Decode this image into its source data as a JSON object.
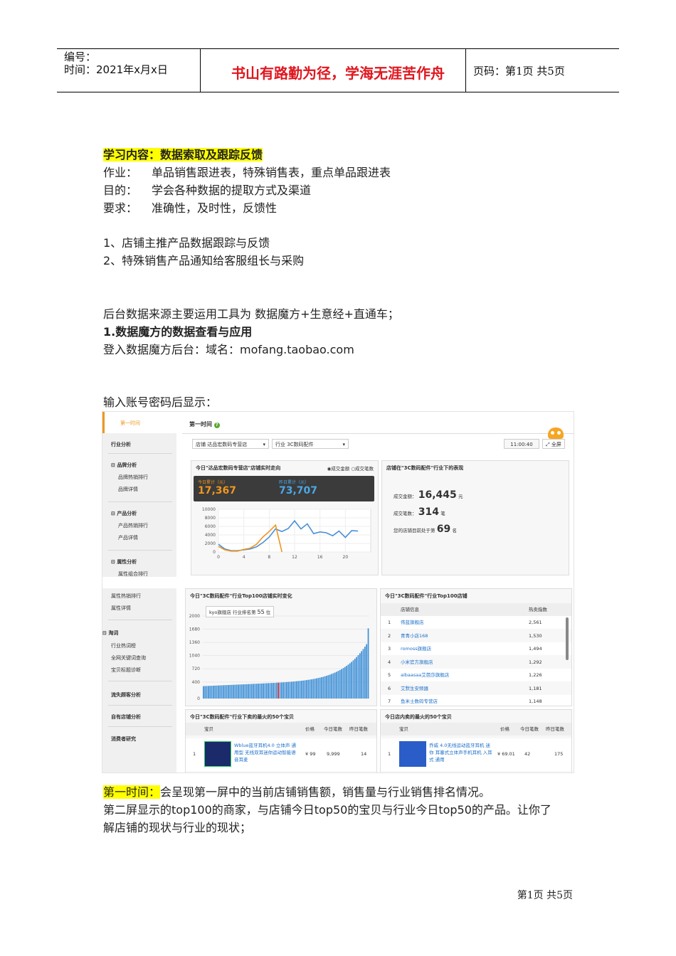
{
  "header": {
    "number_label": "编号：",
    "date_label": "时间：2021年x月x日",
    "motto": "书山有路勤为径，学海无涯苦作舟",
    "page_label": "页码：第1页 共5页"
  },
  "intro": {
    "study_content": "学习内容：数据索取及跟踪反馈",
    "rows": [
      {
        "label": "作业：",
        "value": "单品销售跟进表，特殊销售表，重点单品跟进表"
      },
      {
        "label": "目的：",
        "value": "学会各种数据的提取方式及渠道"
      },
      {
        "label": "要求：",
        "value": "准确性，及时性，反馈性"
      }
    ],
    "list": [
      "1、店铺主推产品数据跟踪与反馈",
      "2、特殊销售产品通知给客服组长与采购"
    ],
    "tools": "后台数据来源主要运用工具为 数据魔方+生意经+直通车；",
    "section_title": "1.数据魔方的数据查看与应用",
    "login": "登入数据魔方后台：域名：mofang.taobao.com",
    "after_login": "输入账号密码后显示："
  },
  "screenshot": {
    "logo": "第一时间",
    "page_title": "第一时间",
    "sidebar_top": [
      {
        "label": "行业分析",
        "bold": true
      },
      {
        "label": "品牌分析",
        "bold": true
      },
      {
        "label": "品牌热销排行",
        "bold": false
      },
      {
        "label": "品牌详情",
        "bold": false
      },
      {
        "label": "产品分析",
        "bold": true
      },
      {
        "label": "产品热销排行",
        "bold": false
      },
      {
        "label": "产品详情",
        "bold": false
      },
      {
        "label": "属性分析",
        "bold": true
      },
      {
        "label": "属性组合排行",
        "bold": false
      }
    ],
    "sidebar_bottom": [
      {
        "label": "属性热销排行",
        "bold": false
      },
      {
        "label": "属性详情",
        "bold": false
      },
      {
        "label": "淘词",
        "bold": true
      },
      {
        "label": "行业热词榜",
        "bold": false
      },
      {
        "label": "全网关键词查询",
        "bold": false
      },
      {
        "label": "宝贝标题诊断",
        "bold": false
      },
      {
        "label": "流失顾客分析",
        "bold": true
      },
      {
        "label": "自有店铺分析",
        "bold": true
      },
      {
        "label": "消费者研究",
        "bold": true
      }
    ],
    "shop_select": "店铺  达品宏数码专营店",
    "industry_select": "行业  3C数码配件",
    "time": "11:00:40",
    "fullscreen": "全屏",
    "trend_title": "今日\"达品宏数码专营店\"店铺实时走向",
    "radio_amount": "成交金额",
    "radio_count": "成交笔数",
    "today_label": "今日累计（元）",
    "today_value": "17,367",
    "yesterday_label": "昨日累计（元）",
    "yesterday_value": "73,707",
    "perf_title": "店铺在\"3C数码配件\"行业下的表现",
    "amount_label": "成交金额：",
    "amount_value": "16,445",
    "amount_unit": "元",
    "count_label": "成交笔数：",
    "count_value": "314",
    "count_unit": "笔",
    "rank_label": "您的店铺目前处于第",
    "rank_value": "69",
    "rank_unit": "名",
    "top100_change_title": "今日\"3C数码配件\"行业Top100店铺实时变化",
    "tooltip_shop": "kyo旗舰店",
    "tooltip_rank_label": "行业排名第",
    "tooltip_rank": "55",
    "tooltip_unit": "位",
    "top100_title": "今日\"3C数码配件\"行业Top100店铺",
    "top100_col_shop": "店铺信息",
    "top100_col_index": "热卖指数",
    "top100_rows": [
      {
        "rank": "1",
        "shop": "伟蓝旗舰店",
        "index": "2,561"
      },
      {
        "rank": "2",
        "shop": "青青小店168",
        "index": "1,530"
      },
      {
        "rank": "3",
        "shop": "romoss旗舰店",
        "index": "1,494"
      },
      {
        "rank": "4",
        "shop": "小米官方旗舰店",
        "index": "1,292"
      },
      {
        "rank": "5",
        "shop": "aibaasaa艾芭莎旗舰店",
        "index": "1,226"
      },
      {
        "rank": "6",
        "shop": "艾默生安频器",
        "index": "1,181"
      },
      {
        "rank": "7",
        "shop": "鱼米士数码专营店",
        "index": "1,148"
      }
    ],
    "ind50_title": "今日\"3C数码配件\"行业下卖的最火的50个宝贝",
    "shop50_title": "今日店内卖的最火的50个宝贝",
    "col_item": "宝贝",
    "col_price": "价格",
    "col_today": "今日笔数",
    "col_yesterday": "昨日笔数",
    "ind50_item": {
      "rank": "1",
      "name": "Wblue蓝牙耳机4.0 立体声 通用型 无线双耳迷你运动智能语音耳麦",
      "price": "¥ 99",
      "today": "9,999",
      "yesterday": "14"
    },
    "shop50_item": {
      "rank": "1",
      "name": "乔威 4.0无线运动蓝牙耳机 迷你 耳塞式立体声手机耳机 入耳式 通用",
      "price": "¥ 69.01",
      "today": "42",
      "yesterday": "175"
    }
  },
  "chart_data": [
    {
      "type": "line",
      "title": "今日\"达品宏数码专营店\"店铺实时走向",
      "x_ticks": [
        0,
        4,
        8,
        12,
        16,
        20
      ],
      "y_ticks": [
        0,
        2000,
        4000,
        6000,
        8000,
        10000
      ],
      "ylim": [
        0,
        10000
      ],
      "xlim": [
        0,
        24
      ],
      "series": [
        {
          "name": "成交金额",
          "color": "#4a90d9",
          "x": [
            0,
            1,
            2,
            3,
            4,
            5,
            6,
            7,
            8,
            9,
            10,
            11,
            12,
            13,
            14,
            15,
            16,
            17,
            18,
            19,
            20,
            21,
            22
          ],
          "y": [
            1800,
            700,
            300,
            300,
            500,
            700,
            1200,
            2200,
            3500,
            5400,
            4800,
            5500,
            7300,
            5400,
            6600,
            4300,
            4700,
            4500,
            3800,
            4900,
            3400,
            5000,
            4900
          ]
        },
        {
          "name": "今日",
          "color": "#f0961e",
          "x": [
            0,
            1,
            2,
            3,
            4,
            5,
            6,
            7,
            8,
            9,
            10
          ],
          "y": [
            1300,
            500,
            200,
            200,
            600,
            900,
            1800,
            3500,
            4800,
            6300,
            0
          ]
        }
      ]
    },
    {
      "type": "bar",
      "title": "今日\"3C数码配件\"行业Top100店铺实时变化",
      "y_ticks": [
        0,
        400,
        720,
        1040,
        1360,
        1680,
        2000
      ],
      "ylim": [
        0,
        2000
      ],
      "count": 100,
      "highlight_index": 45
    }
  ]
}
